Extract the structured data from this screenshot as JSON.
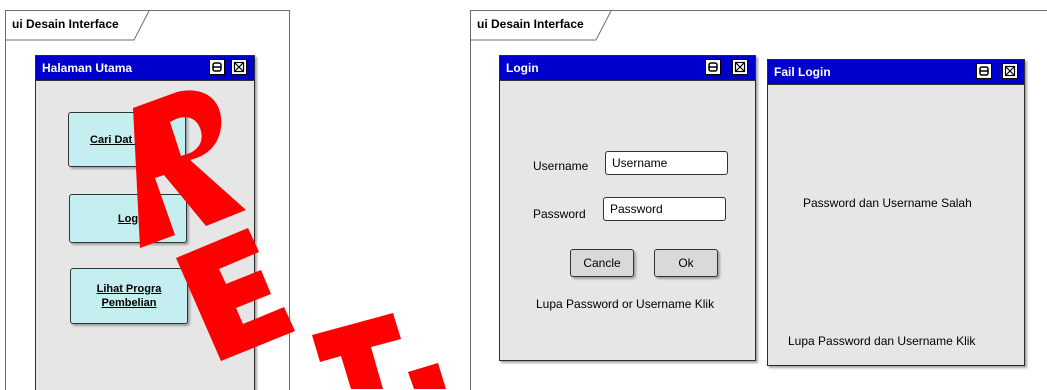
{
  "frames": [
    {
      "label": "ui Desain Interface"
    },
    {
      "label": "ui Desain Interface"
    }
  ],
  "halaman_utama": {
    "title": "Halaman Utama",
    "buttons": {
      "cari": "Cari Dat   kum",
      "login": "Log",
      "lihat_line1": "Lihat Progra",
      "lihat_line2": "Pembelian"
    }
  },
  "login": {
    "title": "Login",
    "username_label": "Username",
    "username_value": "Username",
    "password_label": "Password",
    "password_value": "Password",
    "cancel_label": "Cancle",
    "ok_label": "Ok",
    "forgot_text": "Lupa Password or Username Klik"
  },
  "fail_login": {
    "title": "Fail Login",
    "message": "Password dan Username Salah",
    "forgot_text": "Lupa Password dan Username Klik"
  },
  "watermark": {
    "letters": [
      "R",
      "E",
      "T"
    ],
    "color": "#ff0000"
  },
  "colors": {
    "title_bar": "#0000cd",
    "window_bg": "#e6e6e6",
    "nav_button": "#c5eef0",
    "action_button": "#d9d9d9"
  }
}
